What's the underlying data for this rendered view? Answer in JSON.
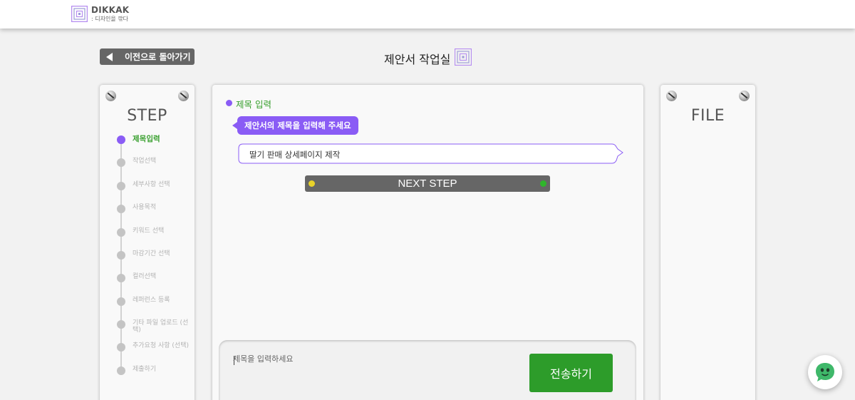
{
  "header": {
    "logo_name": "DIKKAK",
    "logo_sub": ": 디자인을 깎다"
  },
  "nav": {
    "back_label": "이전으로 돌아가기",
    "page_title": "제안서 작업실"
  },
  "steps_panel": {
    "title": "STEP",
    "items": [
      {
        "label": "제목입력",
        "active": true
      },
      {
        "label": "작업선택",
        "active": false
      },
      {
        "label": "세부사항 선택",
        "active": false
      },
      {
        "label": "사용목적",
        "active": false
      },
      {
        "label": "키워드 선택",
        "active": false
      },
      {
        "label": "마감기간 선택",
        "active": false
      },
      {
        "label": "컬러선택",
        "active": false
      },
      {
        "label": "레퍼런스 등록",
        "active": false
      },
      {
        "label": "기타 파일 업로드 (선택)",
        "active": false
      },
      {
        "label": "추가요청 사항 (선택)",
        "active": false
      },
      {
        "label": "제출하기",
        "active": false
      }
    ]
  },
  "chat": {
    "section_label": "제목 입력",
    "bot_message": "제안서의 제목을 입력해 주세요",
    "user_answer": "딸기 판매 상세페이지 제작",
    "next_button": "NEXT STEP",
    "input_placeholder": "제목을 입력하세요",
    "send_button": "전송하기"
  },
  "file_panel": {
    "title": "FILE"
  },
  "colors": {
    "accent_purple": "#8a5cf5",
    "accent_green": "#2d9c2a",
    "button_gray": "#666666"
  },
  "icons": {
    "logo": "dikkak-logo-icon",
    "back": "back-arrow-icon",
    "title": "dikkak-logo-icon",
    "chat_widget": "chat-bot-icon"
  }
}
